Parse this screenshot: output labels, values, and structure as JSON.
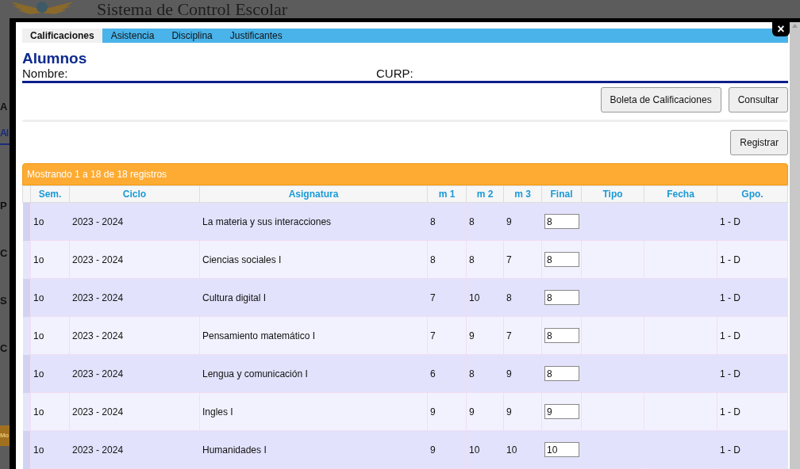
{
  "page": {
    "title": "Sistema de Control Escolar",
    "fragments": [
      {
        "kind": "navtext",
        "text": "A"
      },
      {
        "kind": "heading",
        "text": "Al"
      },
      {
        "kind": "label",
        "text": "P"
      },
      {
        "kind": "label",
        "text": "C"
      },
      {
        "kind": "label",
        "text": "S"
      },
      {
        "kind": "label",
        "text": "C"
      },
      {
        "kind": "button",
        "text": "Mo"
      }
    ]
  },
  "dialog": {
    "close": "×",
    "tabs": [
      {
        "label": "Calificaciones",
        "selected": true
      },
      {
        "label": "Asistencia",
        "selected": false
      },
      {
        "label": "Disciplina",
        "selected": false
      },
      {
        "label": "Justificantes",
        "selected": false
      }
    ],
    "heading": "Alumnos",
    "name_label": "Nombre:",
    "curp_label": "CURP:",
    "buttons": [
      "Boleta de Calificaciones",
      "Consultar"
    ],
    "register_button": "Registrar",
    "table": {
      "info": "Mostrando 1 a 18 de 18 registros",
      "columns": [
        "Sem.",
        "Ciclo",
        "Asignatura",
        "m 1",
        "m 2",
        "m 3",
        "Final",
        "Tipo",
        "Fecha",
        "Gpo."
      ],
      "rows": [
        {
          "sem": "1o",
          "ciclo": "2023 - 2024",
          "asignatura": "La materia y sus interacciones",
          "m1": "8",
          "m2": "8",
          "m3": "9",
          "final": "8",
          "gpo": "1 - D"
        },
        {
          "sem": "1o",
          "ciclo": "2023 - 2024",
          "asignatura": "Ciencias sociales I",
          "m1": "8",
          "m2": "8",
          "m3": "7",
          "final": "8",
          "gpo": "1 - D"
        },
        {
          "sem": "1o",
          "ciclo": "2023 - 2024",
          "asignatura": "Cultura digital I",
          "m1": "7",
          "m2": "10",
          "m3": "8",
          "final": "8",
          "gpo": "1 - D"
        },
        {
          "sem": "1o",
          "ciclo": "2023 - 2024",
          "asignatura": "Pensamiento matemático I",
          "m1": "7",
          "m2": "9",
          "m3": "7",
          "final": "8",
          "gpo": "1 - D"
        },
        {
          "sem": "1o",
          "ciclo": "2023 - 2024",
          "asignatura": "Lengua y comunicación I",
          "m1": "6",
          "m2": "8",
          "m3": "9",
          "final": "8",
          "gpo": "1 - D"
        },
        {
          "sem": "1o",
          "ciclo": "2023 - 2024",
          "asignatura": "Ingles I",
          "m1": "9",
          "m2": "9",
          "m3": "9",
          "final": "9",
          "gpo": "1 - D"
        },
        {
          "sem": "1o",
          "ciclo": "2023 - 2024",
          "asignatura": "Humanidades I",
          "m1": "9",
          "m2": "10",
          "m3": "10",
          "final": "10",
          "gpo": "1 - D"
        }
      ]
    }
  }
}
